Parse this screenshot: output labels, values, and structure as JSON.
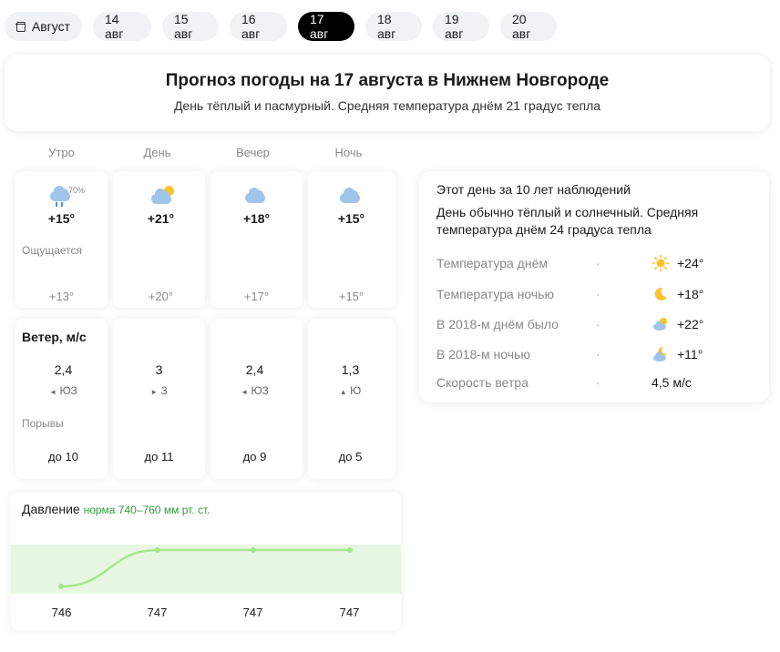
{
  "tabs": [
    {
      "label": "Август",
      "icon": "calendar-icon"
    },
    {
      "label": "14 авг"
    },
    {
      "label": "15 авг"
    },
    {
      "label": "16 авг"
    },
    {
      "label": "17 авг",
      "active": true
    },
    {
      "label": "18 авг"
    },
    {
      "label": "19 авг"
    },
    {
      "label": "20 авг"
    }
  ],
  "header": {
    "title": "Прогноз погоды на 17 августа в Нижнем Новгороде",
    "subtitle": "День тёплый и пасмурный. Средняя температура днём 21 градус тепла"
  },
  "forecast": {
    "periods": [
      "Утро",
      "День",
      "Вечер",
      "Ночь"
    ],
    "temps": [
      "+15°",
      "+21°",
      "+18°",
      "+15°"
    ],
    "icons": [
      "cloud-rain-icon",
      "partly-cloudy-icon",
      "cloudy-icon",
      "cloudy-icon"
    ],
    "precip_prob": "70%",
    "feels_label": "Ощущается",
    "feels": [
      "+13°",
      "+20°",
      "+17°",
      "+15°"
    ]
  },
  "wind": {
    "title": "Ветер, м/с",
    "speeds": [
      "2,4",
      "3",
      "2,4",
      "1,3"
    ],
    "arrows": [
      "◄",
      "►",
      "◄",
      "▲"
    ],
    "dirs": [
      "ЮЗ",
      "З",
      "ЮЗ",
      "Ю"
    ],
    "gust_label": "Порывы",
    "gusts": [
      "до 10",
      "до 11",
      "до 9",
      "до 5"
    ]
  },
  "pressure": {
    "title": "Давление",
    "norm": "норма 740–760 мм рт. ст.",
    "values": [
      746,
      747,
      747,
      747
    ],
    "norm_range": [
      740,
      760
    ]
  },
  "climate": {
    "title": "Этот день за 10 лет наблюдений",
    "description": "День обычно тёплый и солнечный. Средняя температура днём 24 градуса тепла",
    "rows": [
      {
        "label": "Температура днём",
        "icon": "sun-icon",
        "value": "+24°"
      },
      {
        "label": "Температура ночью",
        "icon": "moon-icon",
        "value": "+18°"
      },
      {
        "label": "В 2018-м днём было",
        "icon": "partly-cloudy-icon",
        "value": "+22°"
      },
      {
        "label": "В 2018-м ночью",
        "icon": "cloudy-night-icon",
        "value": "+11°"
      },
      {
        "label": "Скорость ветра",
        "icon": "",
        "value": "4,5 м/с"
      }
    ]
  },
  "colors": {
    "accent": "#000000",
    "norm_green": "#2e9e3c",
    "sun": "#ffc12a",
    "cloud": "#9fc6ea"
  }
}
